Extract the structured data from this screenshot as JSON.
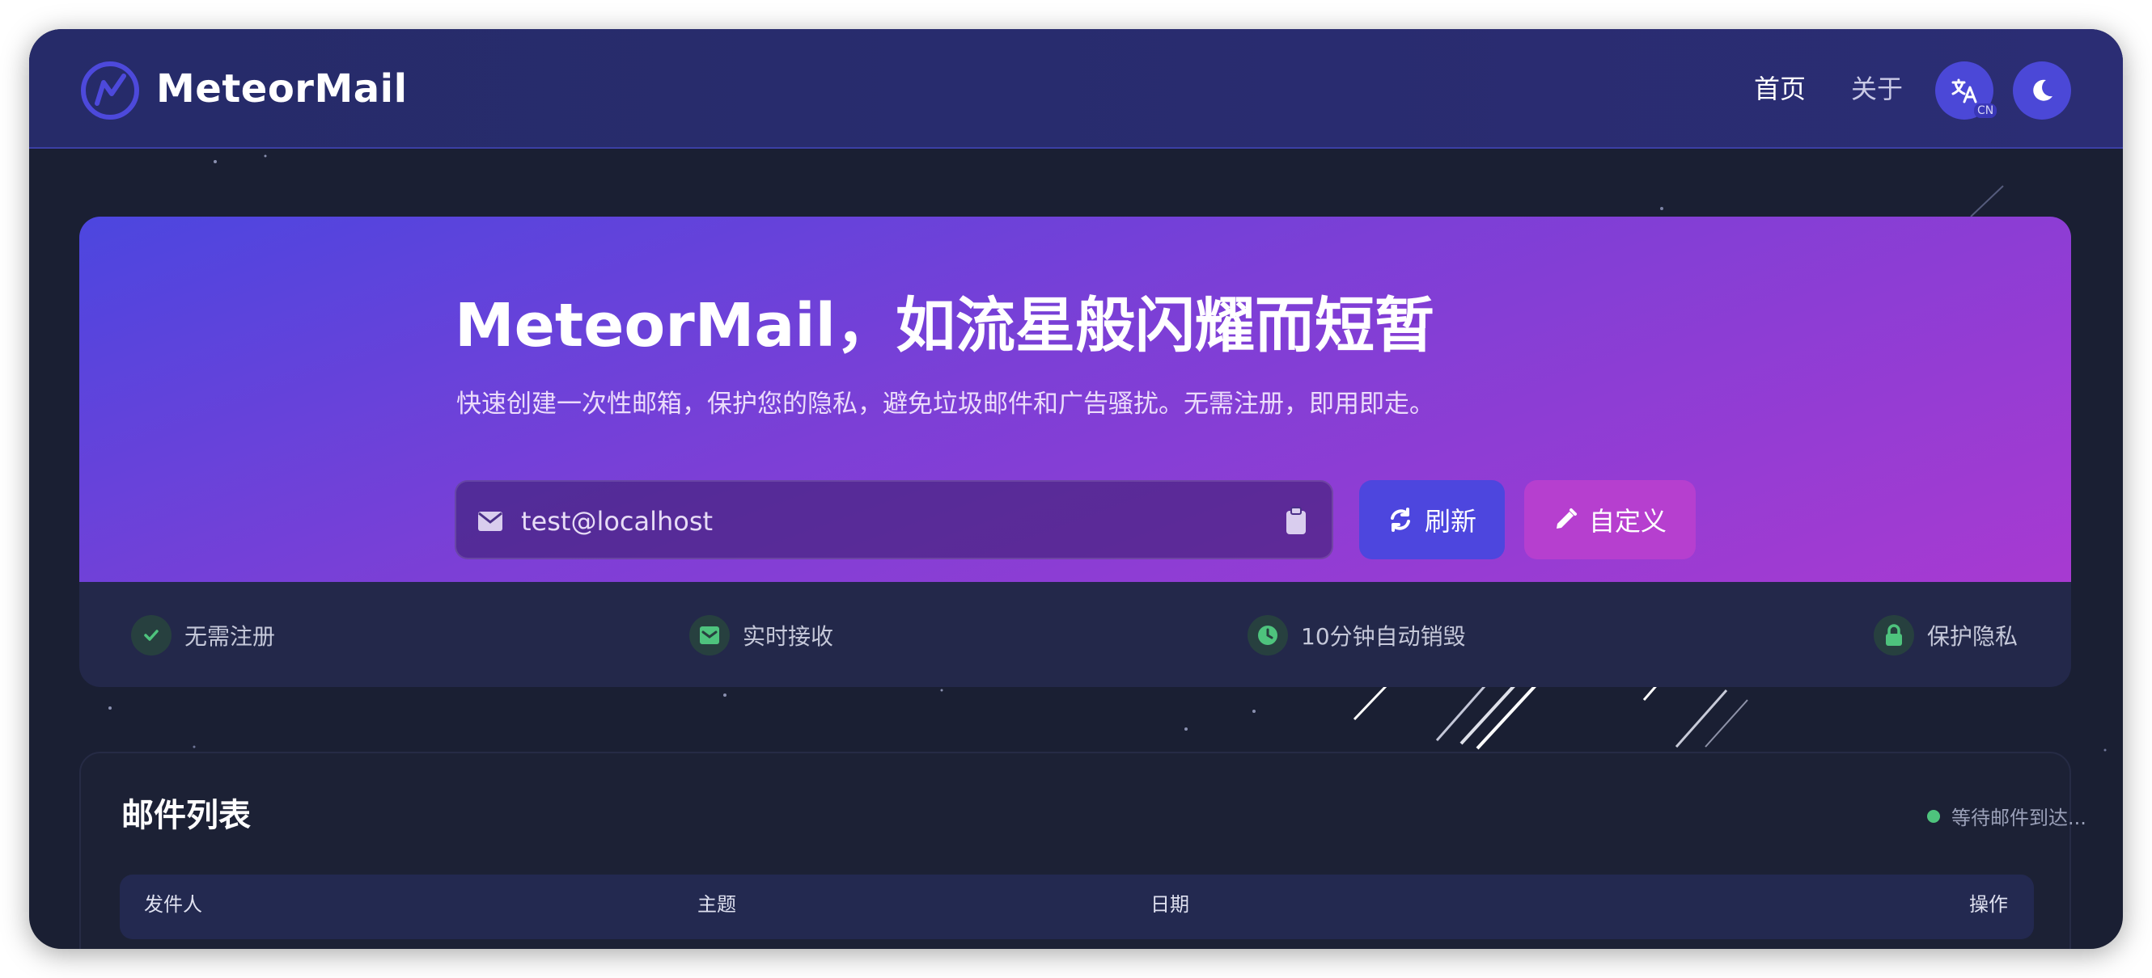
{
  "header": {
    "brand": "MeteorMail",
    "nav": {
      "home": "首页",
      "about": "关于"
    },
    "lang_badge": "CN",
    "icons": [
      "meteor-logo-icon",
      "translate-icon",
      "moon-icon"
    ]
  },
  "hero": {
    "title": "MeteorMail，如流星般闪耀而短暂",
    "subtitle": "快速创建一次性邮箱，保护您的隐私，避免垃圾邮件和广告骚扰。无需注册，即用即走。",
    "email": "test@localhost",
    "refresh_label": "刷新",
    "custom_label": "自定义"
  },
  "features": [
    {
      "label": "无需注册",
      "icon": "check-icon"
    },
    {
      "label": "实时接收",
      "icon": "inbox-icon"
    },
    {
      "label": "10分钟自动销毁",
      "icon": "clock-icon"
    },
    {
      "label": "保护隐私",
      "icon": "lock-icon"
    }
  ],
  "mail_list": {
    "title": "邮件列表",
    "status": "等待邮件到达...",
    "columns": [
      "发件人",
      "主题",
      "日期",
      "操作"
    ]
  },
  "colors": {
    "accent": "#4d46de",
    "custom_button": "#b63fcf",
    "status_green": "#4ec37d",
    "header_bg": "#262b69",
    "page_bg": "#1a1f33"
  }
}
